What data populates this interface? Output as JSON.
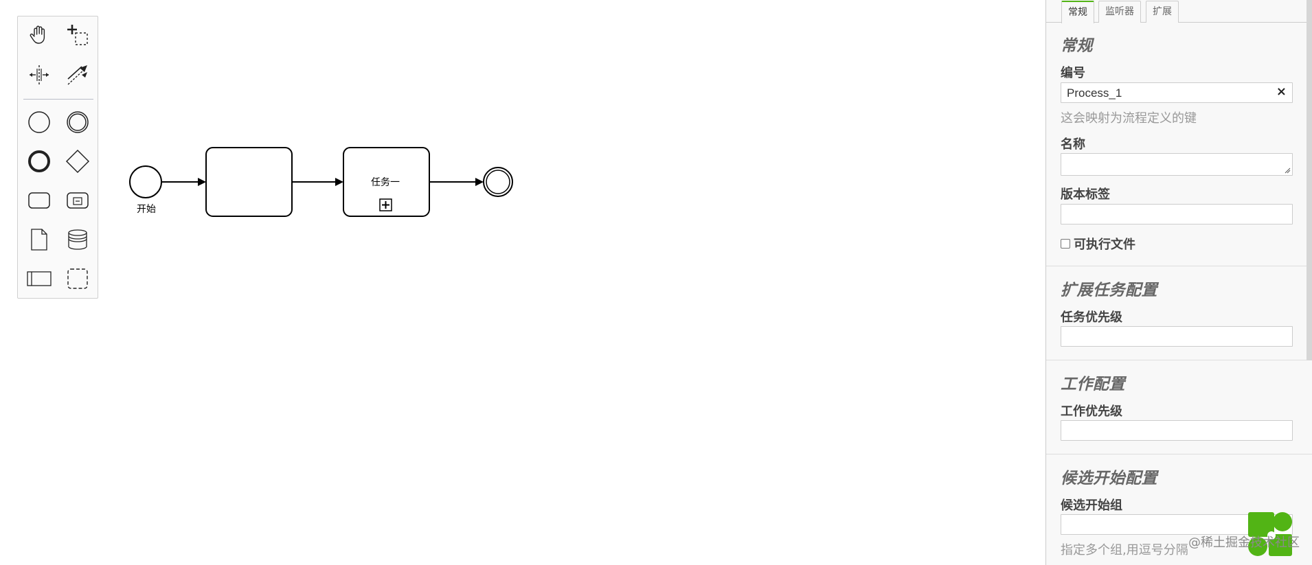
{
  "palette": {
    "tools": [
      {
        "name": "hand-tool",
        "icon": "hand-icon"
      },
      {
        "name": "lasso-tool",
        "icon": "lasso-icon"
      },
      {
        "name": "space-tool",
        "icon": "space-icon"
      },
      {
        "name": "global-connect-tool",
        "icon": "connect-icon"
      },
      {
        "name": "create-start-event",
        "icon": "start-event-icon"
      },
      {
        "name": "create-intermediate-event",
        "icon": "intermediate-event-icon"
      },
      {
        "name": "create-end-event",
        "icon": "end-event-icon"
      },
      {
        "name": "create-gateway",
        "icon": "gateway-icon"
      },
      {
        "name": "create-task",
        "icon": "task-icon"
      },
      {
        "name": "create-subprocess",
        "icon": "subprocess-icon"
      },
      {
        "name": "create-data-object",
        "icon": "data-object-icon"
      },
      {
        "name": "create-data-store",
        "icon": "data-store-icon"
      },
      {
        "name": "create-pool",
        "icon": "pool-icon"
      },
      {
        "name": "create-group",
        "icon": "group-icon"
      }
    ]
  },
  "diagram": {
    "start_label": "开始",
    "task2_label": "任务一"
  },
  "panel": {
    "tabs": [
      {
        "label": "常规",
        "active": true
      },
      {
        "label": "监听器",
        "active": false
      },
      {
        "label": "扩展",
        "active": false
      }
    ],
    "general": {
      "title": "常规",
      "id_label": "编号",
      "id_value": "Process_1",
      "id_hint": "这会映射为流程定义的键",
      "name_label": "名称",
      "name_value": "",
      "version_label": "版本标签",
      "version_value": "",
      "executable_label": "可执行文件"
    },
    "task_ext": {
      "title": "扩展任务配置",
      "priority_label": "任务优先级",
      "priority_value": ""
    },
    "job": {
      "title": "工作配置",
      "priority_label": "工作优先级",
      "priority_value": ""
    },
    "starter": {
      "title": "候选开始配置",
      "groups_label": "候选开始组",
      "groups_value": "",
      "groups_hint": "指定多个组,用逗号分隔"
    }
  },
  "watermark": "@稀土掘金技术社区",
  "colors": {
    "accent": "#52b415",
    "logo": "#52b415"
  }
}
